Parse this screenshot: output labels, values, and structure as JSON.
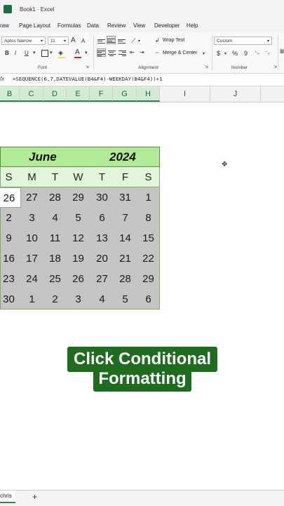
{
  "window": {
    "title": "Book1  ·  Excel"
  },
  "menu": [
    "raw",
    "Page Layout",
    "Formulas",
    "Data",
    "Review",
    "View",
    "Developer",
    "Help"
  ],
  "ribbon": {
    "font_name": "Aptos Narrow",
    "font_size": "11",
    "bold": "B",
    "italic": "I",
    "underline": "U",
    "grow": "A",
    "shrink": "A",
    "wrap_text": "Wrap Text",
    "merge_center": "Merge & Center",
    "number_format": "Custom",
    "currency": "$",
    "percent": "%",
    "comma": "9",
    "group_font": "Font",
    "group_alignment": "Alignment",
    "group_number": "Number"
  },
  "formula_bar": {
    "fx": "fx",
    "formula": "=SEQUENCE(6,7,DATEVALUE(B4&F4)-WEEKDAY(B4&F4))+1"
  },
  "columns": [
    "B",
    "C",
    "D",
    "E",
    "F",
    "G",
    "H",
    "I",
    "J"
  ],
  "calendar": {
    "month": "June",
    "year": "2024",
    "days_of_week": [
      "S",
      "M",
      "T",
      "W",
      "T",
      "F",
      "S"
    ],
    "weeks": [
      [
        "26",
        "27",
        "28",
        "29",
        "30",
        "31",
        "1"
      ],
      [
        "2",
        "3",
        "4",
        "5",
        "6",
        "7",
        "8"
      ],
      [
        "9",
        "10",
        "11",
        "12",
        "13",
        "14",
        "15"
      ],
      [
        "16",
        "17",
        "18",
        "19",
        "20",
        "21",
        "22"
      ],
      [
        "23",
        "24",
        "25",
        "26",
        "27",
        "28",
        "29"
      ],
      [
        "30",
        "1",
        "2",
        "3",
        "4",
        "5",
        "6"
      ]
    ]
  },
  "caption": {
    "line1": "Click Conditional",
    "line2": "Formatting"
  },
  "sheets": {
    "active": "chris",
    "add": "+"
  }
}
